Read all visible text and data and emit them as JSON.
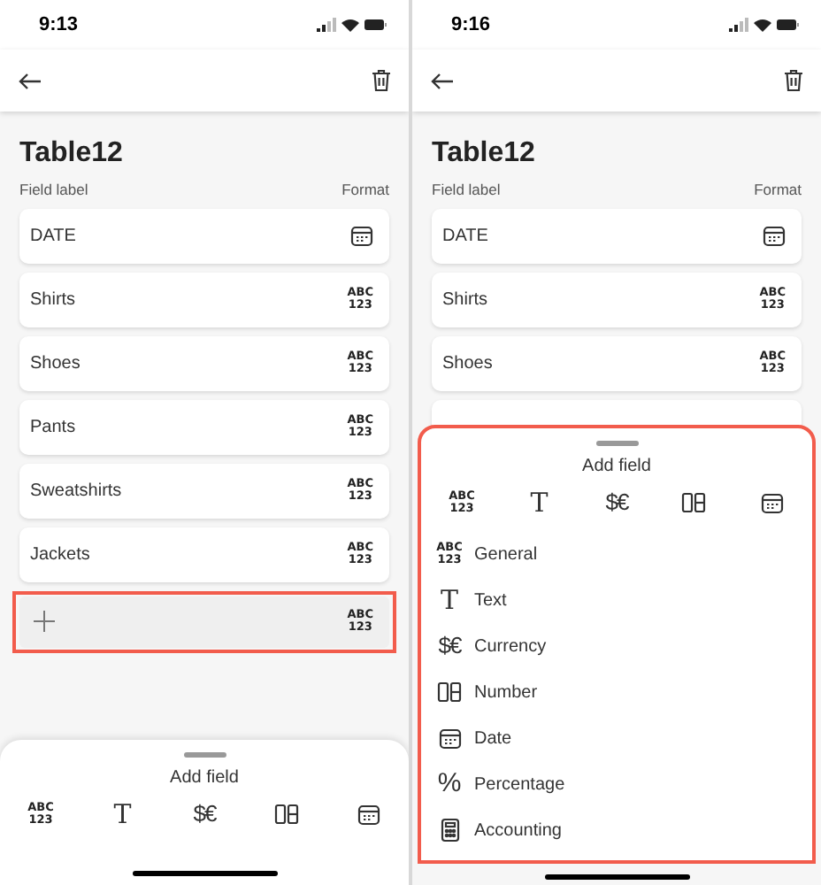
{
  "screens": [
    {
      "status_time": "9:13",
      "title": "Table12",
      "column_labels": {
        "label": "Field label",
        "format": "Format"
      },
      "fields": [
        {
          "label": "DATE",
          "kind": "date"
        },
        {
          "label": "Shirts",
          "kind": "general",
          "glyph": [
            "ABC",
            "123"
          ]
        },
        {
          "label": "Shoes",
          "kind": "general",
          "glyph": [
            "ABC",
            "123"
          ]
        },
        {
          "label": "Pants",
          "kind": "general",
          "glyph": [
            "ABC",
            "123"
          ]
        },
        {
          "label": "Sweatshirts",
          "kind": "general",
          "glyph": [
            "ABC",
            "123"
          ]
        },
        {
          "label": "Jackets",
          "kind": "general",
          "glyph": [
            "ABC",
            "123"
          ]
        }
      ],
      "new_field": {
        "highlighted": true,
        "kind": "general",
        "glyph": [
          "ABC",
          "123"
        ]
      },
      "sheet": {
        "title": "Add field",
        "expanded": false,
        "highlighted": false,
        "toolbar": [
          {
            "kind": "general",
            "glyph": [
              "ABC",
              "123"
            ]
          },
          {
            "kind": "text",
            "glyph": "T"
          },
          {
            "kind": "currency",
            "glyph": "$€"
          },
          {
            "kind": "number"
          },
          {
            "kind": "date"
          }
        ]
      }
    },
    {
      "status_time": "9:16",
      "title": "Table12",
      "column_labels": {
        "label": "Field label",
        "format": "Format"
      },
      "fields": [
        {
          "label": "DATE",
          "kind": "date"
        },
        {
          "label": "Shirts",
          "kind": "general",
          "glyph": [
            "ABC",
            "123"
          ]
        },
        {
          "label": "Shoes",
          "kind": "general",
          "glyph": [
            "ABC",
            "123"
          ]
        }
      ],
      "sheet": {
        "title": "Add field",
        "expanded": true,
        "highlighted": true,
        "toolbar": [
          {
            "kind": "general",
            "glyph": [
              "ABC",
              "123"
            ]
          },
          {
            "kind": "text",
            "glyph": "T"
          },
          {
            "kind": "currency",
            "glyph": "$€"
          },
          {
            "kind": "number"
          },
          {
            "kind": "date"
          }
        ],
        "options": [
          {
            "kind": "general",
            "glyph": [
              "ABC",
              "123"
            ],
            "label": "General"
          },
          {
            "kind": "text",
            "glyph": "T",
            "label": "Text"
          },
          {
            "kind": "currency",
            "glyph": "$€",
            "label": "Currency"
          },
          {
            "kind": "number",
            "label": "Number"
          },
          {
            "kind": "date",
            "label": "Date"
          },
          {
            "kind": "percentage",
            "glyph": "%",
            "label": "Percentage"
          },
          {
            "kind": "accounting",
            "label": "Accounting"
          }
        ]
      }
    }
  ]
}
